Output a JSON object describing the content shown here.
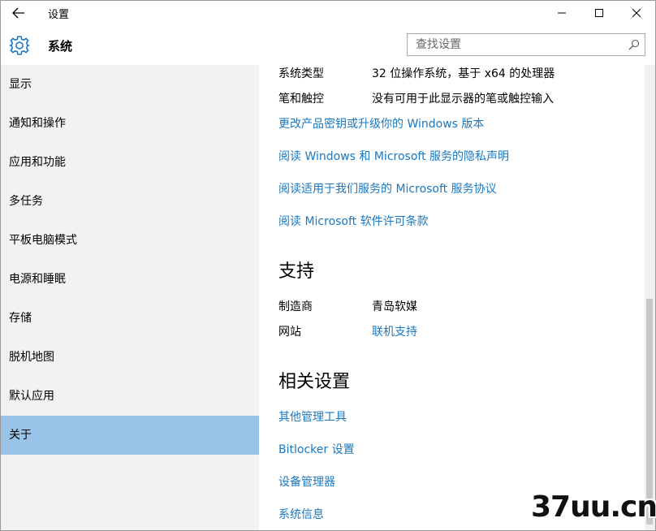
{
  "window": {
    "title": "设置"
  },
  "header": {
    "title": "系统",
    "search_placeholder": "查找设置"
  },
  "sidebar": {
    "items": [
      {
        "label": "显示"
      },
      {
        "label": "通知和操作"
      },
      {
        "label": "应用和功能"
      },
      {
        "label": "多任务"
      },
      {
        "label": "平板电脑模式"
      },
      {
        "label": "电源和睡眠"
      },
      {
        "label": "存储"
      },
      {
        "label": "脱机地图"
      },
      {
        "label": "默认应用"
      },
      {
        "label": "关于",
        "selected": true
      }
    ]
  },
  "about": {
    "system_type_label": "系统类型",
    "system_type_value": "32 位操作系统，基于 x64 的处理器",
    "pen_touch_label": "笔和触控",
    "pen_touch_value": "没有可用于此显示器的笔或触控输入",
    "links": [
      "更改产品密钥或升级你的 Windows 版本",
      "阅读 Windows 和 Microsoft 服务的隐私声明",
      "阅读适用于我们服务的 Microsoft 服务协议",
      "阅读 Microsoft 软件许可条款"
    ]
  },
  "support": {
    "heading": "支持",
    "manufacturer_label": "制造商",
    "manufacturer_value": "青岛软媒",
    "website_label": "网站",
    "website_link": "联机支持"
  },
  "related": {
    "heading": "相关设置",
    "links": [
      "其他管理工具",
      "Bitlocker 设置",
      "设备管理器",
      "系统信息"
    ]
  },
  "watermark": {
    "text": "37uu.cn"
  },
  "colors": {
    "accent": "#1a78c2",
    "selected": "#99c4e8",
    "sidebar_bg": "#f2f2f2"
  }
}
